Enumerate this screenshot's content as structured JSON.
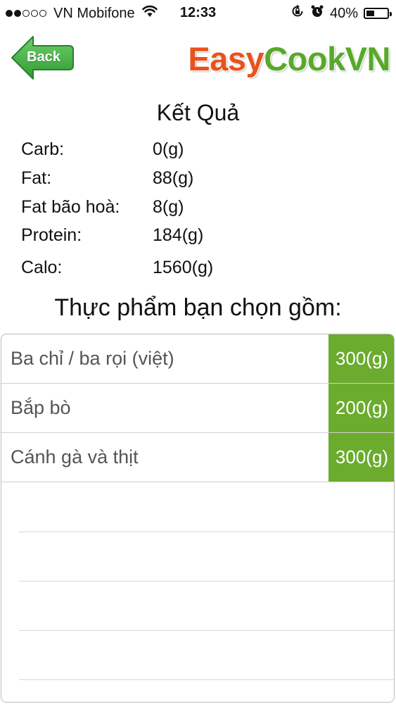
{
  "status_bar": {
    "carrier": "VN Mobifone",
    "time": "12:33",
    "battery": "40%",
    "battery_level": 0.4
  },
  "header": {
    "back_label": "Back",
    "logo_part1": "Easy",
    "logo_part2": "CookVN",
    "colors": {
      "logo_orange": "#e8531c",
      "logo_green": "#58a92a",
      "back_green": "#4bb548"
    }
  },
  "results": {
    "title": "Kết Quả",
    "nutrients": [
      {
        "label": "Carb:",
        "value": "0(g)"
      },
      {
        "label": "Fat:",
        "value": "88(g)"
      },
      {
        "label": "Fat bão hoà:",
        "value": "8(g)"
      },
      {
        "label": "Protein:",
        "value": "184(g)"
      },
      {
        "label": "Calo:",
        "value": "1560(g)"
      }
    ]
  },
  "foods": {
    "heading": "Thực phẩm bạn chọn gồm:",
    "accent_color": "#6bab2d",
    "items": [
      {
        "name": "Ba chỉ / ba rọi (việt)",
        "qty": "300(g)"
      },
      {
        "name": "Bắp bò",
        "qty": "200(g)"
      },
      {
        "name": "Cánh gà và thịt",
        "qty": "300(g)"
      }
    ]
  }
}
